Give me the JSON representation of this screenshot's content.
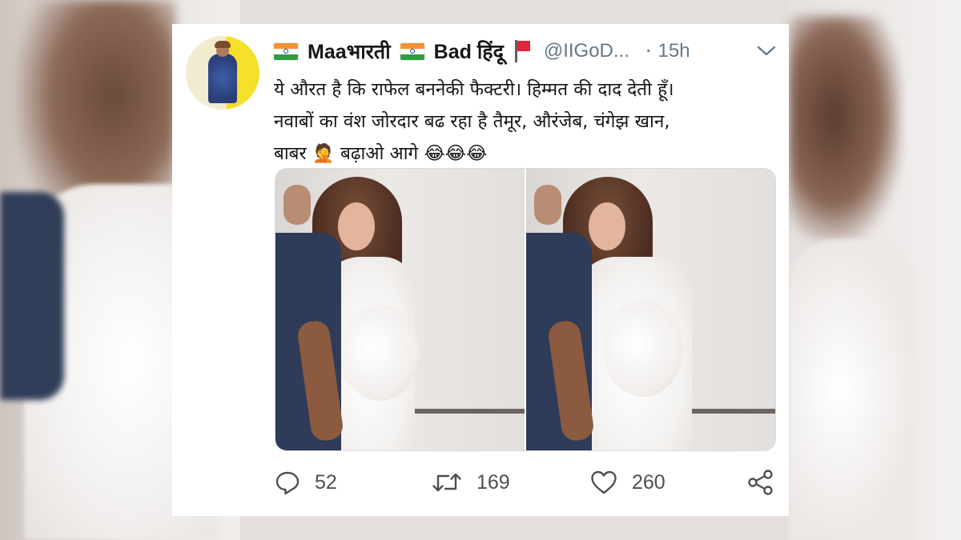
{
  "tweet": {
    "display_name_part1": "Maaभारती",
    "display_name_part2": "Bad हिंदू",
    "handle": "@IIGoD...",
    "separator": "·",
    "time": "15h",
    "text_lines": [
      "ये औरत है कि राफेल बननेकी फैक्टरी। हिम्मत की दाद देती हूँ।",
      "नवाबों का वंश जोरदार बढ रहा है तैमूर, औरंजेब, चंगेझ खान,",
      "बाबर 🤦 बढ़ाओ आगे 😂😂😂"
    ]
  },
  "icons": {
    "avatar": "profile-avatar",
    "flag1": "india-flag-icon",
    "flag2": "india-flag-icon",
    "flag3": "red-flag-icon",
    "caret": "chevron-down-icon",
    "reply": "reply-icon",
    "retweet": "retweet-icon",
    "like": "heart-icon",
    "share": "share-icon"
  },
  "actions": {
    "reply_count": "52",
    "retweet_count": "169",
    "like_count": "260"
  },
  "colors": {
    "text": "#14171a",
    "secondary": "#657786",
    "icon": "#4d4f52",
    "card_bg": "#ffffff"
  }
}
